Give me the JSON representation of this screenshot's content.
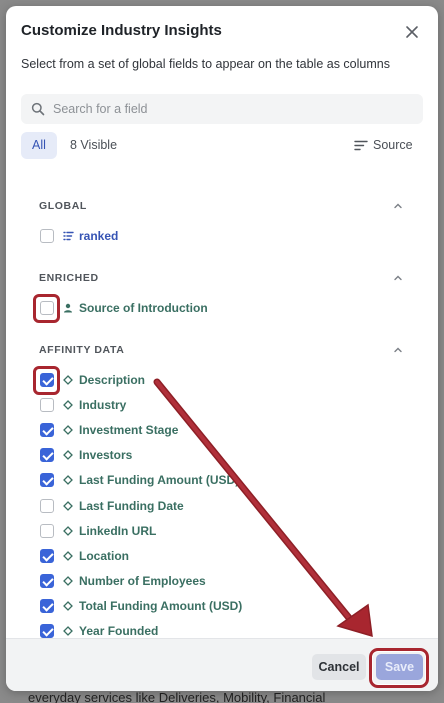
{
  "backdrop": {
    "text": "everyday services like Deliveries, Mobility, Financial"
  },
  "modal": {
    "title": "Customize Industry Insights",
    "subtitle": "Select from a set of global fields to appear on the table as columns",
    "search": {
      "placeholder": "Search for a field",
      "value": ""
    },
    "tabs": {
      "all": "All",
      "visible": "8 Visible"
    },
    "source_label": "Source",
    "sections": [
      {
        "header": "GLOBAL",
        "fields": [
          {
            "label": "ranked",
            "checked": false,
            "icon": "list-icon"
          }
        ]
      },
      {
        "header": "ENRICHED",
        "fields": [
          {
            "label": "Source of Introduction",
            "checked": false,
            "icon": "person-icon"
          }
        ]
      },
      {
        "header": "AFFINITY DATA",
        "fields": [
          {
            "label": "Description",
            "checked": true,
            "icon": "diamond-icon"
          },
          {
            "label": "Industry",
            "checked": false,
            "icon": "diamond-icon"
          },
          {
            "label": "Investment Stage",
            "checked": true,
            "icon": "diamond-icon"
          },
          {
            "label": "Investors",
            "checked": true,
            "icon": "diamond-icon"
          },
          {
            "label": "Last Funding Amount (USD)",
            "checked": true,
            "icon": "diamond-icon"
          },
          {
            "label": "Last Funding Date",
            "checked": false,
            "icon": "diamond-icon"
          },
          {
            "label": "LinkedIn URL",
            "checked": false,
            "icon": "diamond-icon"
          },
          {
            "label": "Location",
            "checked": true,
            "icon": "diamond-icon"
          },
          {
            "label": "Number of Employees",
            "checked": true,
            "icon": "diamond-icon"
          },
          {
            "label": "Total Funding Amount (USD)",
            "checked": true,
            "icon": "diamond-icon"
          },
          {
            "label": "Year Founded",
            "checked": true,
            "icon": "diamond-icon"
          }
        ]
      }
    ],
    "footer": {
      "cancel_label": "Cancel",
      "save_label": "Save"
    }
  },
  "colors": {
    "accent": "#3a64d8",
    "field_label": "#3a6f62",
    "annotation": "#a8262f"
  }
}
